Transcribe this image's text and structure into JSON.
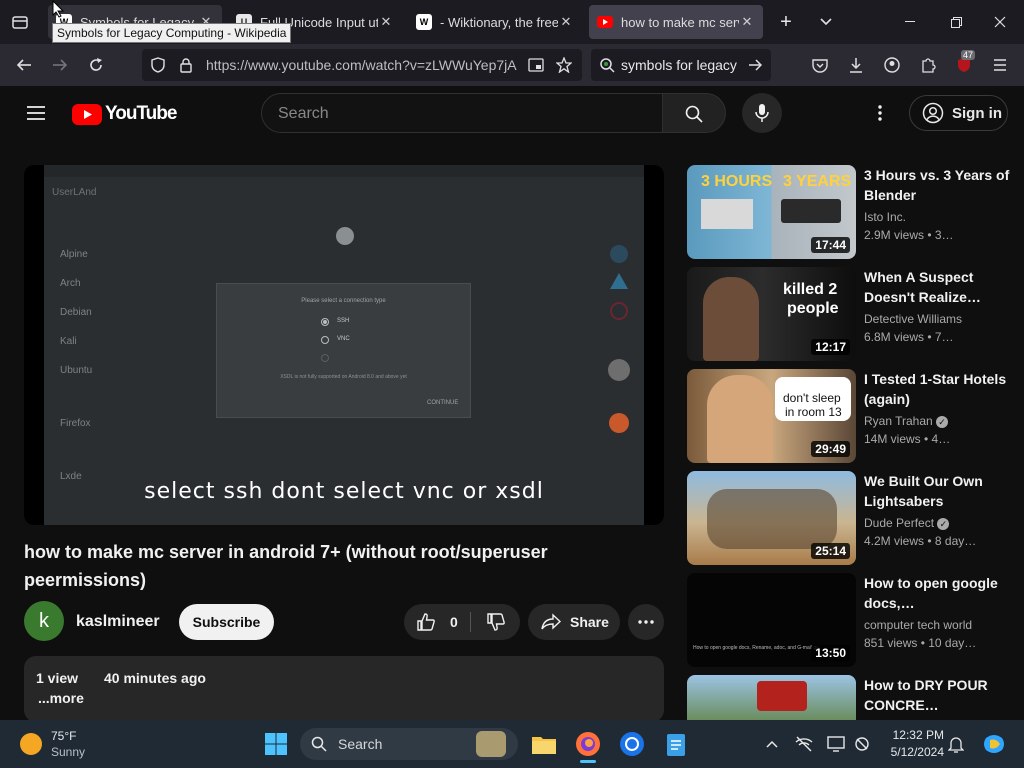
{
  "browser": {
    "tabs": [
      {
        "title": "Symbols for Legacy Co",
        "favicon": "wikipedia-icon"
      },
      {
        "title": "Full Unicode Input utili",
        "favicon": "document-icon"
      },
      {
        "title": "- Wiktionary, the free",
        "favicon": "wiktionary-icon"
      },
      {
        "title": "how to make mc serve",
        "favicon": "youtube-icon",
        "active": true
      }
    ],
    "tooltip": "Symbols for Legacy Computing - Wikipedia",
    "url": "https://www.youtube.com/watch?v=zLWWuYep7jA",
    "search_text": "symbols for legacy c",
    "extension_badge": "47"
  },
  "youtube": {
    "logo_text": "YouTube",
    "search_placeholder": "Search",
    "sign_in": "Sign in",
    "video": {
      "screen": {
        "app_title": "UserLAnd",
        "distros": [
          "Alpine",
          "Arch",
          "Debian",
          "Kali",
          "Ubuntu",
          "Firefox",
          "Lxde"
        ],
        "dialog_title": "Please select a connection type",
        "options": [
          "SSH",
          "VNC"
        ],
        "note": "XSDL is not fully supported on Android 8.0 and above yet",
        "continue": "CONTINUE"
      },
      "caption": "select ssh dont select vnc or xsdl",
      "title": "how to make mc server in android 7+ (without root/superuser peermissions)",
      "channel": "kaslmineer",
      "channel_initial": "k",
      "subscribe": "Subscribe",
      "likes": "0",
      "share": "Share",
      "views": "1 view",
      "age": "40 minutes ago",
      "more": "...more"
    },
    "recommendations": [
      {
        "title": "3 Hours vs. 3 Years of Blender",
        "channel": "Isto Inc.",
        "meta": "2.9M views • 3…",
        "duration": "17:44",
        "thumb_text": [
          "3 HOURS",
          "3 YEARS"
        ],
        "verified": false
      },
      {
        "title": "When A Suspect Doesn't Realize…",
        "channel": "Detective Williams",
        "meta": "6.8M views • 7…",
        "duration": "12:17",
        "thumb_text": [
          "killed 2",
          "people"
        ],
        "verified": false
      },
      {
        "title": "I Tested 1-Star Hotels (again)",
        "channel": "Ryan Trahan",
        "meta": "14M views • 4…",
        "duration": "29:49",
        "thumb_text": [
          "don't sleep",
          "in room 13"
        ],
        "verified": true
      },
      {
        "title": "We Built Our Own Lightsabers",
        "channel": "Dude Perfect",
        "meta": "4.2M views • 8 day…",
        "duration": "25:14",
        "thumb_text": [],
        "verified": true
      },
      {
        "title": "How to open google docs,…",
        "channel": "computer tech world",
        "meta": "851 views • 10 day…",
        "duration": "13:50",
        "thumb_text": [
          "How to open google docs, Rename, adoc, and G-mail go"
        ],
        "verified": false
      },
      {
        "title": "How to DRY POUR CONCRE…",
        "channel": "",
        "meta": "",
        "duration": "",
        "thumb_text": [],
        "verified": false
      }
    ]
  },
  "taskbar": {
    "weather_temp": "75°F",
    "weather_desc": "Sunny",
    "search": "Search",
    "time": "12:32 PM",
    "date": "5/12/2024"
  },
  "colors": {
    "youtube_red": "#ff0000",
    "active_tab": "#42414d",
    "yt_bg": "#0f0f0f"
  }
}
